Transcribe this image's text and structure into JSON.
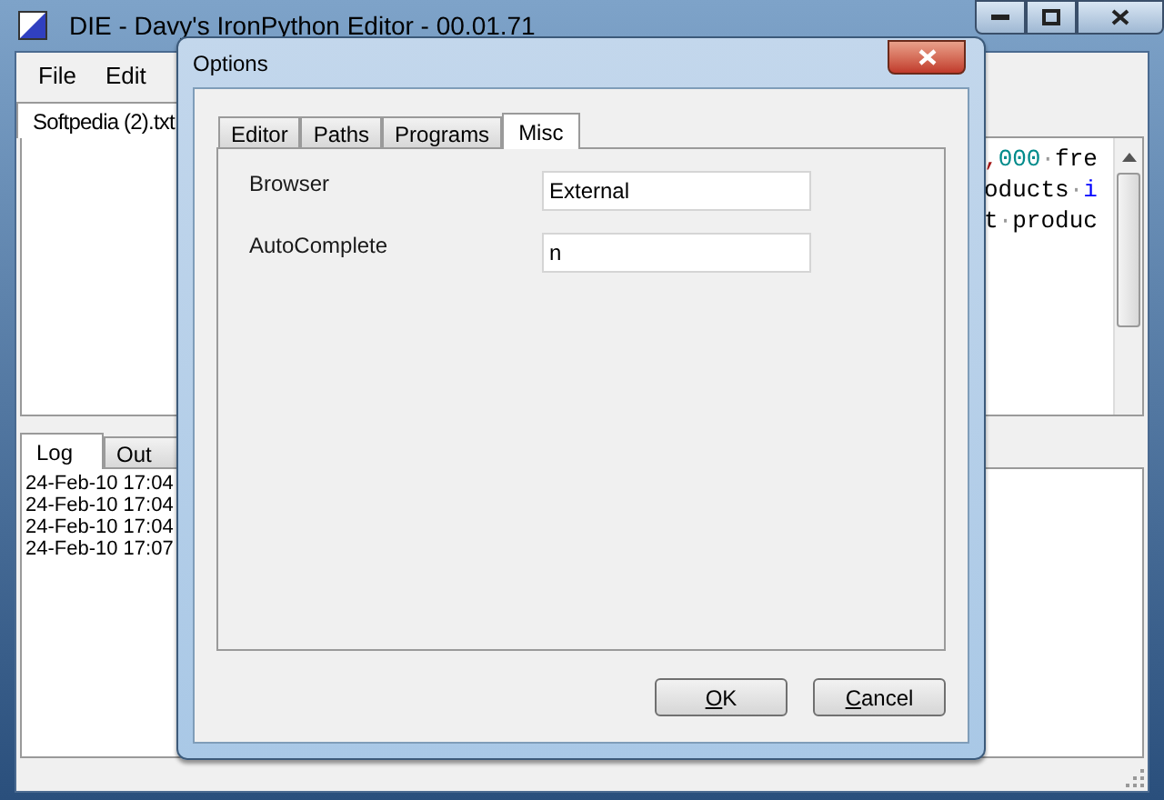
{
  "window": {
    "title": "DIE - Davy's IronPython Editor - 00.01.71"
  },
  "menu": [
    "File",
    "Edit"
  ],
  "document_tabs": [
    {
      "label": "Softpedia (2).txt",
      "selected": true
    }
  ],
  "editor": {
    "lines": [
      [
        {
          "text": ",",
          "color": "#a31515"
        },
        {
          "text": "000",
          "color": "#008b8b"
        },
        {
          "text": "·",
          "color": "#9a9a9a"
        },
        {
          "text": "fre",
          "color": "#000000"
        }
      ],
      [
        {
          "text": "oducts",
          "color": "#000000"
        },
        {
          "text": "·",
          "color": "#9a9a9a"
        },
        {
          "text": "i",
          "color": "#0000ff"
        }
      ],
      [
        {
          "text": "t",
          "color": "#000000"
        },
        {
          "text": "·",
          "color": "#9a9a9a"
        },
        {
          "text": "produc",
          "color": "#000000"
        }
      ]
    ]
  },
  "output_tabs": [
    {
      "label": "Log",
      "selected": true
    },
    {
      "label": "Out",
      "selected": false
    }
  ],
  "log": [
    "24-Feb-10 17:04",
    "24-Feb-10 17:04",
    "24-Feb-10 17:04",
    "24-Feb-10 17:07"
  ],
  "dialog": {
    "title": "Options",
    "tabs": [
      {
        "label": "Editor",
        "selected": false
      },
      {
        "label": "Paths",
        "selected": false
      },
      {
        "label": "Programs",
        "selected": false
      },
      {
        "label": "Misc",
        "selected": true
      }
    ],
    "fields": [
      {
        "label": "Browser",
        "value": "External"
      },
      {
        "label": "AutoComplete",
        "value": "n"
      }
    ],
    "buttons": [
      {
        "accel": "O",
        "rest": "K"
      },
      {
        "accel": "C",
        "rest": "ancel"
      }
    ]
  }
}
